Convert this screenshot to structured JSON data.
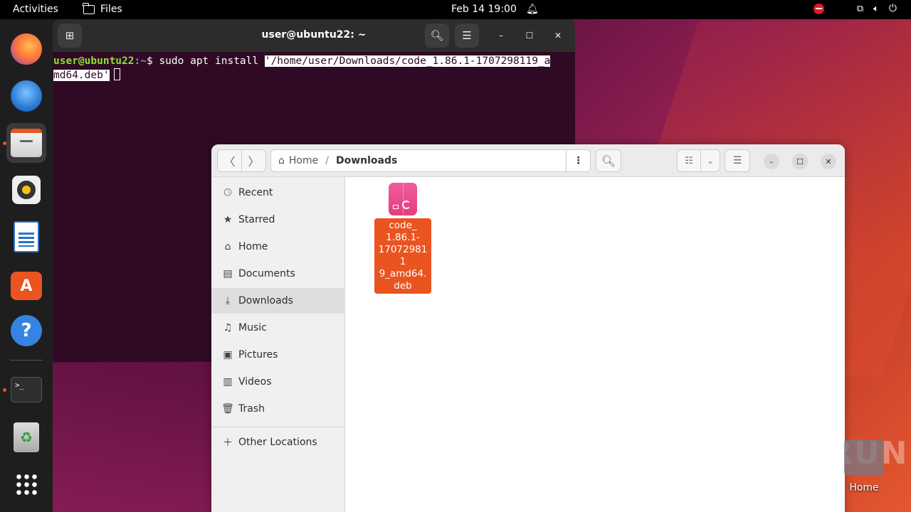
{
  "topbar": {
    "activities": "Activities",
    "app_name": "Files",
    "clock": "Feb 14  19:00"
  },
  "dock": {
    "items": [
      {
        "name": "firefox",
        "color": "#ff7139"
      },
      {
        "name": "thunderbird",
        "color": "#2b7bd5"
      },
      {
        "name": "files",
        "color": "#e95420"
      },
      {
        "name": "rhythmbox",
        "color": "#f5c211"
      },
      {
        "name": "libreoffice-writer",
        "color": "#2a72c6"
      },
      {
        "name": "ubuntu-software",
        "color": "#e95420"
      },
      {
        "name": "help",
        "color": "#3584e4"
      },
      {
        "name": "terminal",
        "color": "#2e2e2e"
      },
      {
        "name": "trash",
        "color": "#9a9a9a"
      },
      {
        "name": "show-apps",
        "color": "#ffffff"
      }
    ]
  },
  "terminal": {
    "title": "user@ubuntu22: ~",
    "prompt_user": "user@ubuntu22",
    "prompt_path": ":~",
    "prompt_symbol": "$ ",
    "command": "sudo apt install ",
    "arg_line1": "'/home/user/Downloads/code_1.86.1-1707298119_a",
    "arg_line2": "md64.deb'"
  },
  "files": {
    "path_home": "Home",
    "path_current": "Downloads",
    "sidebar": [
      {
        "label": "Recent",
        "icon": "clock-icon"
      },
      {
        "label": "Starred",
        "icon": "star-icon"
      },
      {
        "label": "Home",
        "icon": "home-icon"
      },
      {
        "label": "Documents",
        "icon": "document-icon"
      },
      {
        "label": "Downloads",
        "icon": "download-icon"
      },
      {
        "label": "Music",
        "icon": "music-icon"
      },
      {
        "label": "Pictures",
        "icon": "picture-icon"
      },
      {
        "label": "Videos",
        "icon": "video-icon"
      },
      {
        "label": "Trash",
        "icon": "trash-icon"
      },
      {
        "label": "Other Locations",
        "icon": "plus-icon"
      }
    ],
    "file": {
      "label": "code_\n1.86.1-\n170729811\n9_amd64.\ndeb"
    }
  },
  "desktop": {
    "home_label": "Home",
    "watermark": "ANY RUN"
  }
}
